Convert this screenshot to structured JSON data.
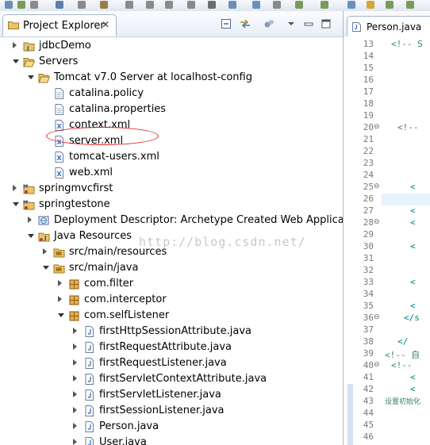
{
  "colors": {
    "accent": "#3a6fc4",
    "annotation": "#e02020",
    "comment": "#3f7f5f",
    "folder": "#d9a53c",
    "package": "#c58b2a"
  },
  "explorer": {
    "tab_label": "Project Explorer",
    "tab_close": "✕",
    "tree": [
      {
        "label": "jdbcDemo",
        "depth": 0,
        "expand": "closed",
        "icon": "java-project-icon"
      },
      {
        "label": "Servers",
        "depth": 0,
        "expand": "open",
        "icon": "folder-open-icon"
      },
      {
        "label": "Tomcat v7.0 Server at localhost-config",
        "depth": 1,
        "expand": "open",
        "icon": "folder-open-icon"
      },
      {
        "label": "catalina.policy",
        "depth": 2,
        "expand": "none",
        "icon": "file-icon"
      },
      {
        "label": "catalina.properties",
        "depth": 2,
        "expand": "none",
        "icon": "file-icon"
      },
      {
        "label": "context.xml",
        "depth": 2,
        "expand": "none",
        "icon": "xml-file-icon"
      },
      {
        "label": "server.xml",
        "depth": 2,
        "expand": "none",
        "icon": "xml-file-icon"
      },
      {
        "label": "tomcat-users.xml",
        "depth": 2,
        "expand": "none",
        "icon": "xml-file-icon"
      },
      {
        "label": "web.xml",
        "depth": 2,
        "expand": "none",
        "icon": "xml-file-icon"
      },
      {
        "label": "springmvcfirst",
        "depth": 0,
        "expand": "closed",
        "icon": "maven-project-icon"
      },
      {
        "label": "springtestone",
        "depth": 0,
        "expand": "open",
        "icon": "maven-project-icon"
      },
      {
        "label": "Deployment Descriptor: Archetype Created Web Application",
        "depth": 1,
        "expand": "closed",
        "icon": "deployment-descriptor-icon"
      },
      {
        "label": "Java Resources",
        "depth": 1,
        "expand": "open",
        "icon": "java-resources-icon"
      },
      {
        "label": "src/main/resources",
        "depth": 2,
        "expand": "closed",
        "icon": "source-folder-icon"
      },
      {
        "label": "src/main/java",
        "depth": 2,
        "expand": "open",
        "icon": "source-folder-icon"
      },
      {
        "label": "com.filter",
        "depth": 3,
        "expand": "closed",
        "icon": "package-icon"
      },
      {
        "label": "com.interceptor",
        "depth": 3,
        "expand": "closed",
        "icon": "package-icon"
      },
      {
        "label": "com.selfListener",
        "depth": 3,
        "expand": "open",
        "icon": "package-icon"
      },
      {
        "label": "firstHttpSessionAttribute.java",
        "depth": 4,
        "expand": "closed",
        "icon": "java-file-icon"
      },
      {
        "label": "firstRequestAttribute.java",
        "depth": 4,
        "expand": "closed",
        "icon": "java-file-icon"
      },
      {
        "label": "firstRequestListener.java",
        "depth": 4,
        "expand": "closed",
        "icon": "java-file-icon"
      },
      {
        "label": "firstServletContextAttribute.java",
        "depth": 4,
        "expand": "closed",
        "icon": "java-file-icon"
      },
      {
        "label": "firstServletListener.java",
        "depth": 4,
        "expand": "closed",
        "icon": "java-file-icon"
      },
      {
        "label": "firstSessionListener.java",
        "depth": 4,
        "expand": "closed",
        "icon": "java-file-icon"
      },
      {
        "label": "Person.java",
        "depth": 4,
        "expand": "closed",
        "icon": "java-file-icon"
      },
      {
        "label": "User.java",
        "depth": 4,
        "expand": "closed",
        "icon": "java-file-icon"
      }
    ],
    "watermark": "http://blog.csdn.net/"
  },
  "editor": {
    "tab_label": "Person.java",
    "line_numbers": [
      "13",
      "14",
      "15",
      "16",
      "17",
      "18",
      "19",
      "20",
      "21",
      "22",
      "23",
      "24",
      "25",
      "26",
      "27",
      "28",
      "29",
      "30",
      "31",
      "32",
      "33",
      "34",
      "35",
      "36",
      "37",
      "38",
      "39",
      "40",
      "41",
      "42",
      "43",
      "44",
      "45",
      "46"
    ],
    "code_lines": [
      {
        "text": "<!-- S",
        "indent": 1
      },
      {
        "text": "",
        "indent": 0
      },
      {
        "text": "",
        "indent": 0
      },
      {
        "text": "",
        "indent": 0
      },
      {
        "text": "",
        "indent": 0
      },
      {
        "text": "",
        "indent": 0
      },
      {
        "text": "",
        "indent": 0
      },
      {
        "text": "<!--",
        "indent": 2
      },
      {
        "text": "",
        "indent": 0
      },
      {
        "text": "",
        "indent": 0
      },
      {
        "text": "",
        "indent": 0
      },
      {
        "text": "",
        "indent": 0
      },
      {
        "text": "<",
        "indent": 4
      },
      {
        "text": "",
        "indent": 0
      },
      {
        "text": "<",
        "indent": 4
      },
      {
        "text": "<",
        "indent": 4
      },
      {
        "text": "",
        "indent": 0
      },
      {
        "text": "<",
        "indent": 4
      },
      {
        "text": "",
        "indent": 0
      },
      {
        "text": "",
        "indent": 0
      },
      {
        "text": "<",
        "indent": 4
      },
      {
        "text": "",
        "indent": 0
      },
      {
        "text": "<",
        "indent": 4
      },
      {
        "text": "</s",
        "indent": 3
      },
      {
        "text": "",
        "indent": 0
      },
      {
        "text": "</",
        "indent": 2
      },
      {
        "text": "<!-- 自",
        "indent": 0
      },
      {
        "text": "<!--",
        "indent": 1
      },
      {
        "text": "<",
        "indent": 4
      },
      {
        "text": "<",
        "indent": 4
      },
      {
        "text": "设置初始化",
        "indent": 0
      },
      {
        "text": "",
        "indent": 0
      },
      {
        "text": "",
        "indent": 0
      },
      {
        "text": "",
        "indent": 0
      }
    ]
  }
}
